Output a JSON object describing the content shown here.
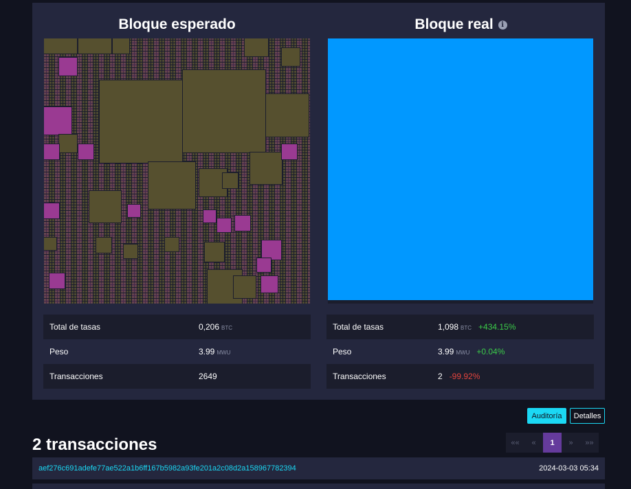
{
  "expected": {
    "title": "Bloque esperado",
    "stats": [
      {
        "label": "Total de tasas",
        "value": "0,206",
        "unit": "BTC"
      },
      {
        "label": "Peso",
        "value": "3.99",
        "unit": "MWU"
      },
      {
        "label": "Transacciones",
        "value": "2649",
        "unit": ""
      }
    ]
  },
  "actual": {
    "title": "Bloque real",
    "info_icon": "info-icon",
    "stats": [
      {
        "label": "Total de tasas",
        "value": "1,098",
        "unit": "BTC",
        "delta": "+434.15%",
        "delta_type": "positive"
      },
      {
        "label": "Peso",
        "value": "3.99",
        "unit": "MWU",
        "delta": "+0.04%",
        "delta_type": "positive"
      },
      {
        "label": "Transacciones",
        "value": "2",
        "unit": "",
        "delta": "-99.92%",
        "delta_type": "negative"
      }
    ]
  },
  "buttons": {
    "audit": "Auditoría",
    "details": "Detalles"
  },
  "transactions": {
    "title": "2 transacciones",
    "pager": [
      "««",
      "«",
      "1",
      "»",
      "»»"
    ],
    "active_page": "1",
    "rows": [
      {
        "txid": "aef276c691adefe77ae522a1b6ff167b5982a93fe201a2c08d2a158967782394",
        "time": "2024-03-03 05:34"
      }
    ]
  },
  "colors": {
    "accent": "#1bd8f4",
    "actual_block": "#0198ff",
    "positive": "#3bcc49",
    "negative": "#e4443d",
    "pager_active": "#653b9c"
  }
}
